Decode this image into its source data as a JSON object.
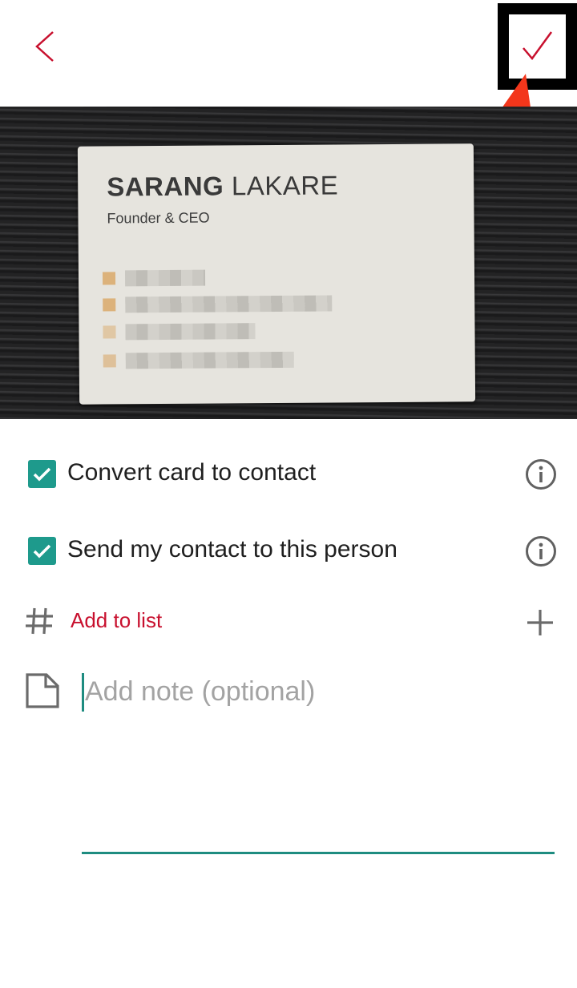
{
  "header": {
    "back_icon": "chevron-left-icon",
    "confirm_icon": "checkmark-icon",
    "accent_color": "#c8102e"
  },
  "card": {
    "name_first": "SARANG",
    "name_last": "LAKARE",
    "title": "Founder & CEO"
  },
  "options": [
    {
      "label": "Convert card to contact",
      "checked": true,
      "icon": "info-icon"
    },
    {
      "label": "Send my contact to this person",
      "checked": true,
      "icon": "info-icon"
    }
  ],
  "list": {
    "label": "Add to list",
    "icon": "hash-icon",
    "action_icon": "plus-icon"
  },
  "note": {
    "placeholder": "Add note (optional)",
    "value": "",
    "icon": "note-icon"
  },
  "colors": {
    "checkbox": "#1e9a8c",
    "underline": "#1e8c80",
    "annotation_arrow": "#f3361b"
  }
}
